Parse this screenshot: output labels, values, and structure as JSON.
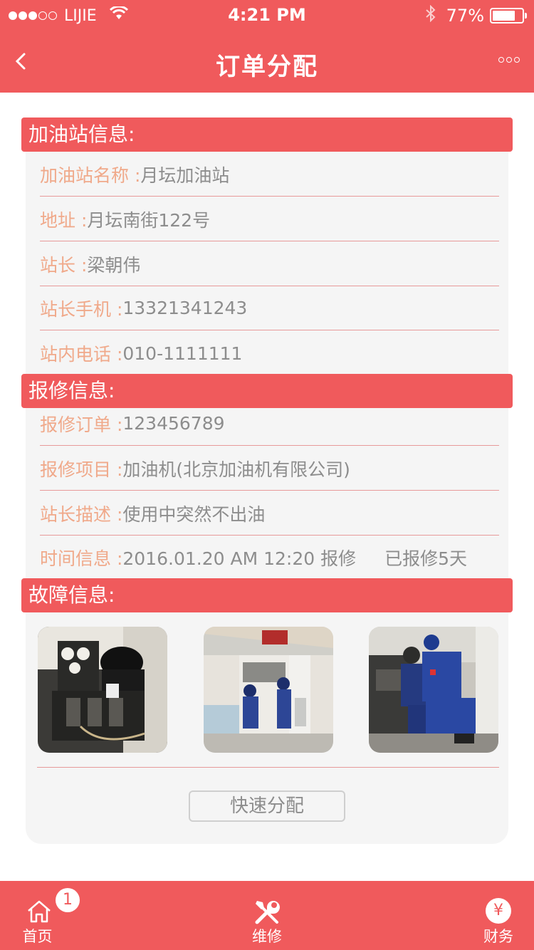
{
  "status_bar": {
    "carrier": "LIJIE",
    "time": "4:21 PM",
    "battery": "77%",
    "battery_level": 0.77,
    "signal_bars": 3,
    "signal_total": 5
  },
  "nav": {
    "back_icon": "chevron-left-icon",
    "title": "订单分配",
    "more_icon": "more-dots-icon"
  },
  "station": {
    "header": "加油站信息:",
    "rows": [
      {
        "label": "加油站名称 : ",
        "value": "月坛加油站"
      },
      {
        "label": "地址 : ",
        "value": "月坛南街122号"
      },
      {
        "label": "站长 : ",
        "value": "梁朝伟"
      },
      {
        "label": "站长手机 : ",
        "value": "13321341243"
      },
      {
        "label": "站内电话 : ",
        "value": "010-1111111"
      }
    ]
  },
  "repair": {
    "header": "报修信息:",
    "rows": [
      {
        "label": "报修订单 : ",
        "value": "123456789"
      },
      {
        "label": "报修项目 : ",
        "value": "加油机(北京加油机有限公司)"
      },
      {
        "label": "站长描述 : ",
        "value": "使用中突然不出油"
      },
      {
        "label": "时间信息 : ",
        "value": "2016.01.20 AM 12:20 报修",
        "extra": "已报修5天"
      }
    ]
  },
  "fault": {
    "header": "故障信息:",
    "photos": [
      "engine-photo",
      "fuel-pump-photo",
      "technicians-photo"
    ]
  },
  "assign_button": "快速分配",
  "tabbar": {
    "tabs": [
      {
        "label": "首页",
        "icon": "home-icon",
        "badge": "1"
      },
      {
        "label": "维修",
        "icon": "tools-icon"
      },
      {
        "label": "财务",
        "icon": "yen-icon",
        "icon_text": "¥"
      }
    ]
  },
  "colors": {
    "primary": "#f05a5c",
    "label": "#f0a98a",
    "value": "#8d8d8d",
    "card": "#f5f5f5"
  }
}
